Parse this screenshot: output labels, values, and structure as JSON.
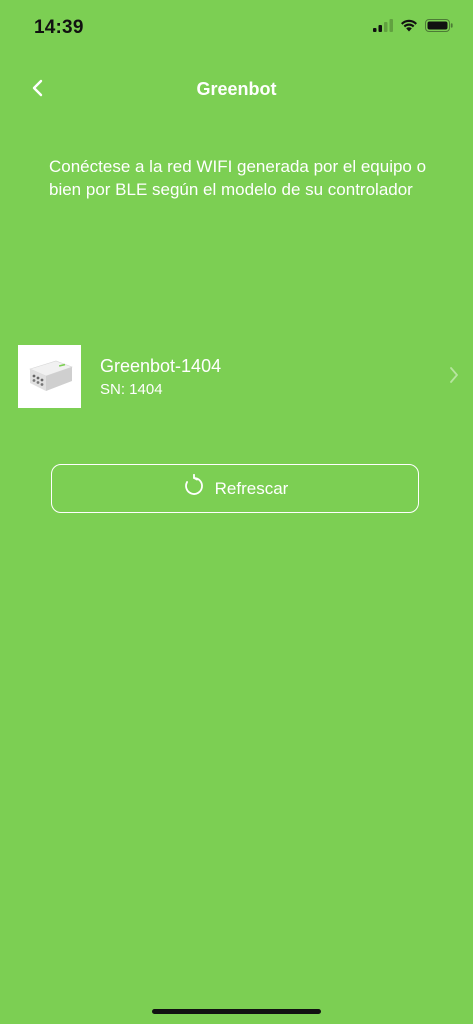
{
  "status_bar": {
    "time": "14:39",
    "icons": [
      "cellular-signal-icon",
      "wifi-icon",
      "battery-icon"
    ]
  },
  "nav": {
    "title": "Greenbot",
    "back_icon": "chevron-left-icon"
  },
  "instructions": "Conéctese a la red WIFI generada por el equipo o bien por BLE según el modelo de su controlador",
  "devices": [
    {
      "name": "Greenbot-1404",
      "sn": "SN: 1404",
      "icon": "controller-device-image"
    }
  ],
  "refresh_button": {
    "label": "Refrescar",
    "icon": "refresh-icon"
  },
  "colors": {
    "background": "#7ccf53",
    "text": "#ffffff",
    "status_text": "#111111"
  }
}
